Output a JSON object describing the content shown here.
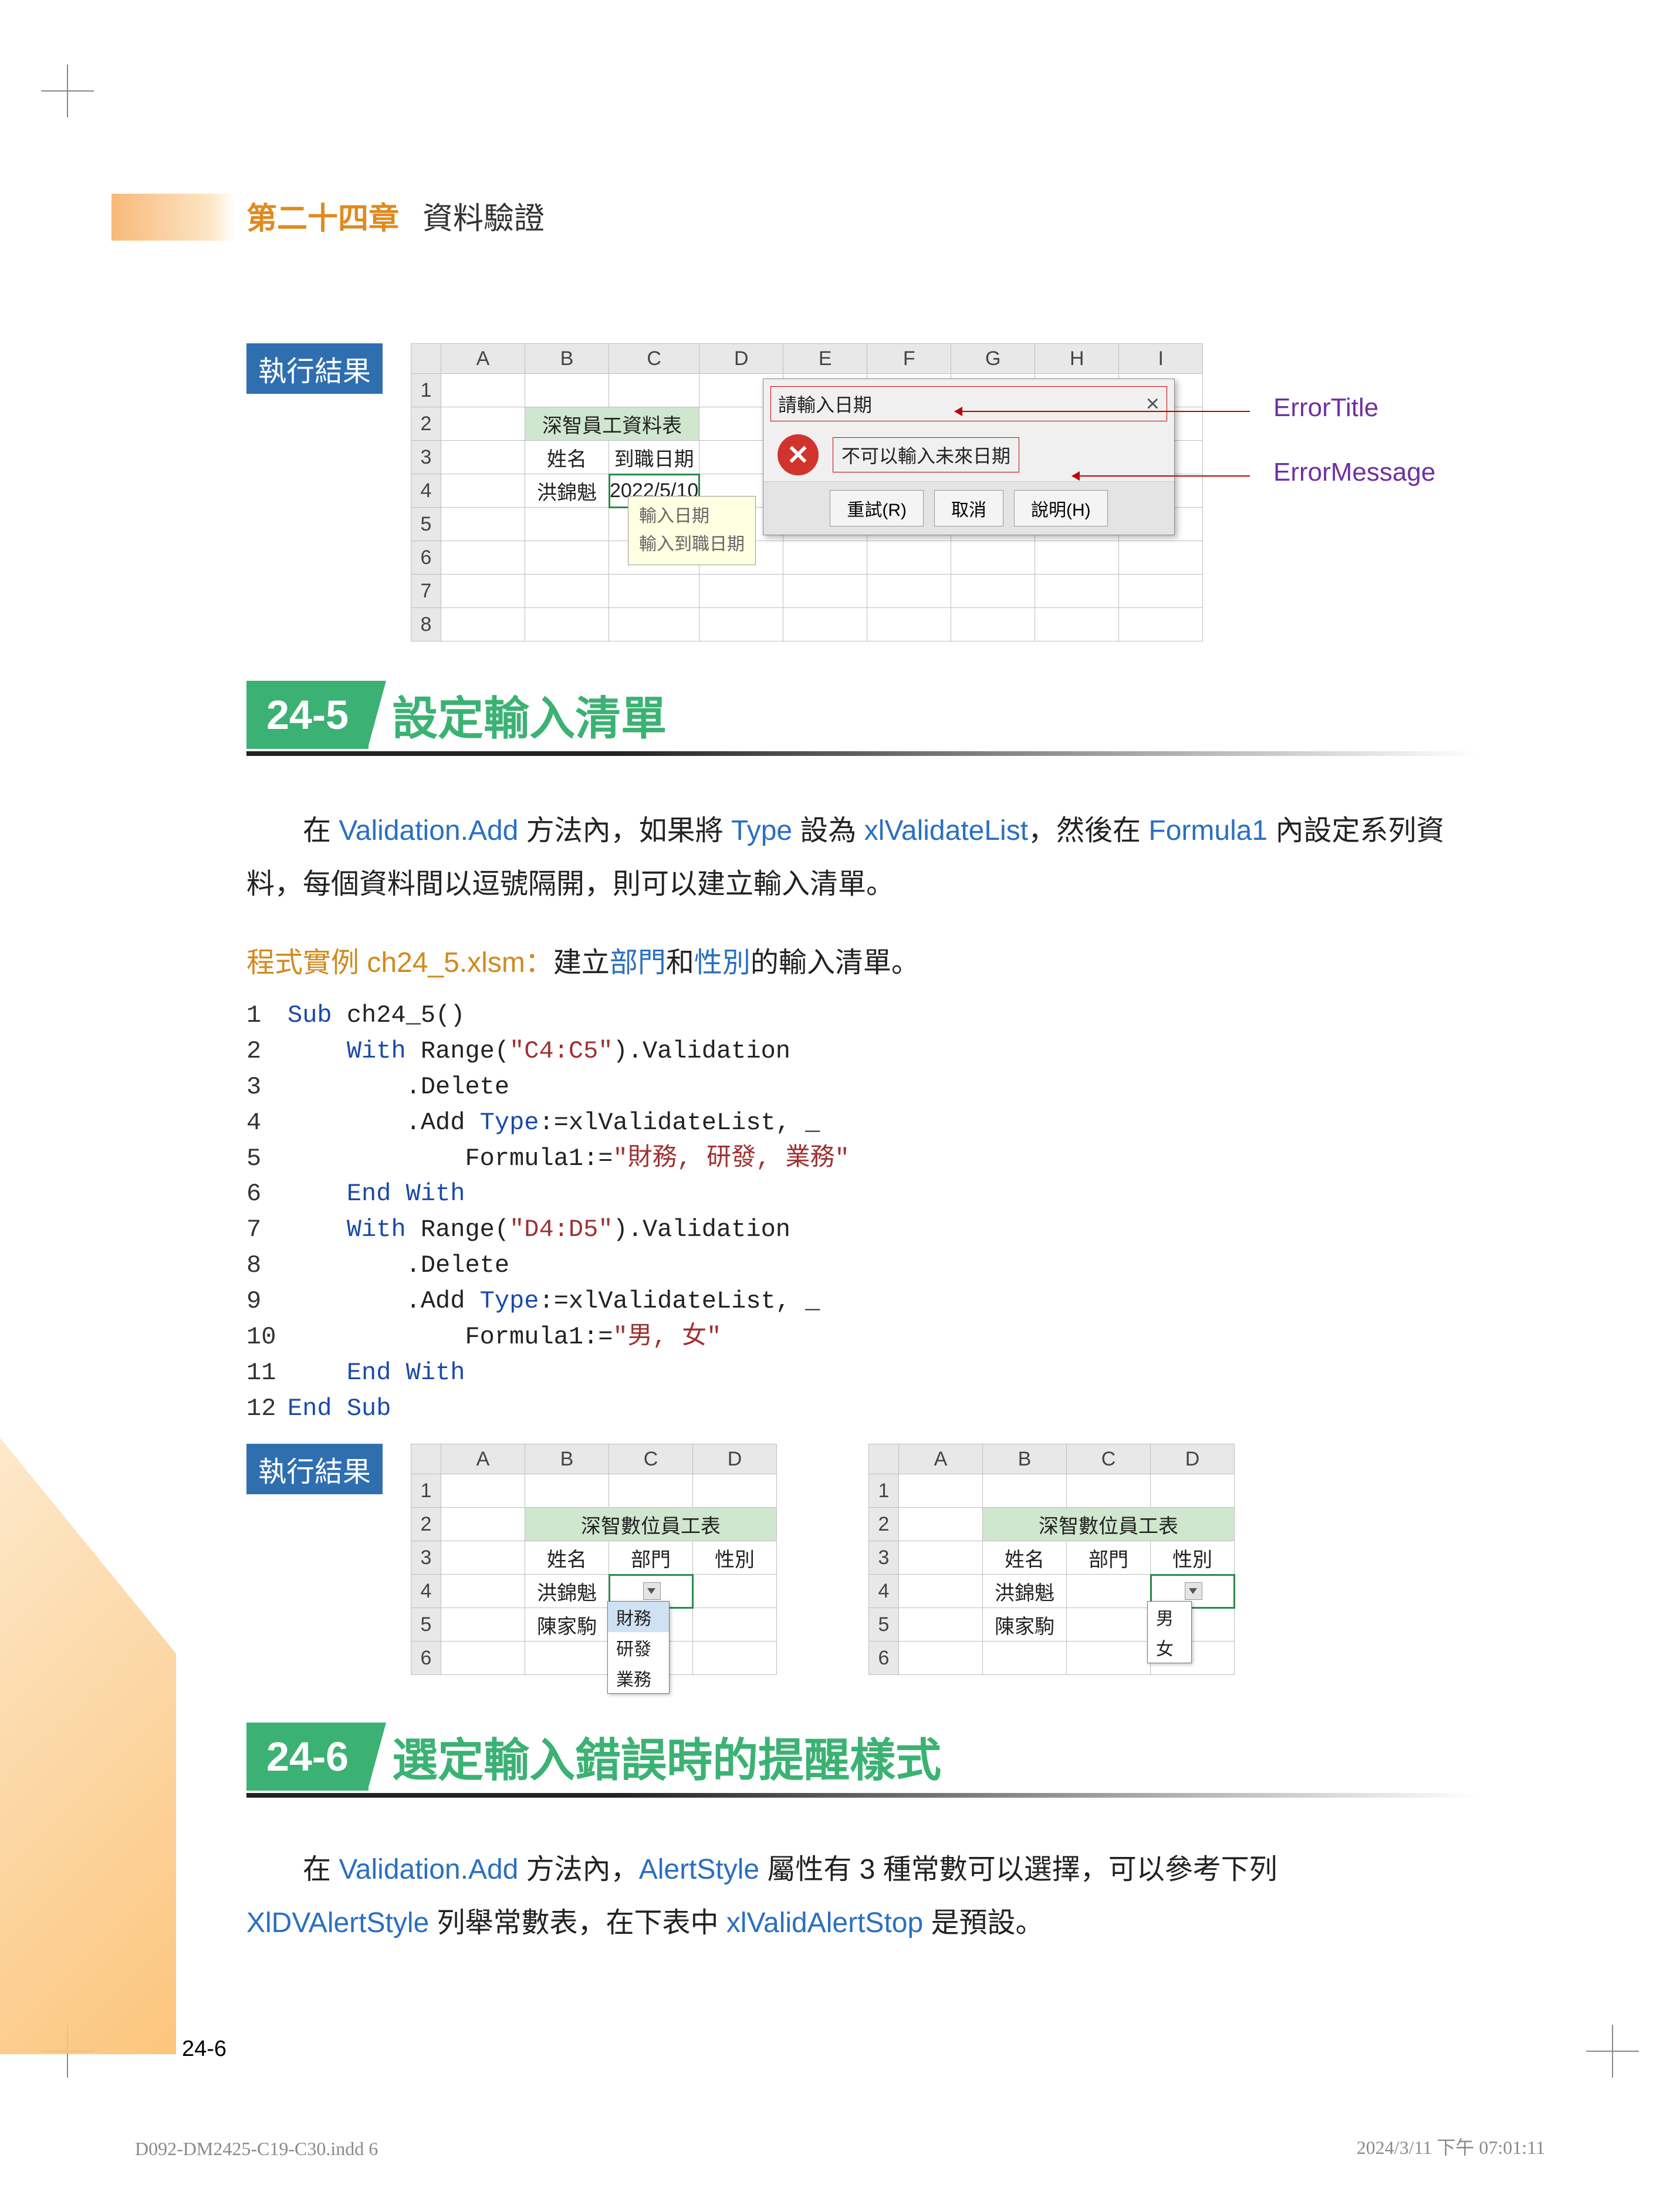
{
  "chapter": {
    "number": "第二十四章",
    "title": "資料驗證"
  },
  "labels": {
    "result": "執行結果"
  },
  "fig1": {
    "cols": [
      "A",
      "B",
      "C",
      "D",
      "E",
      "F",
      "G",
      "H",
      "I"
    ],
    "rows": [
      "1",
      "2",
      "3",
      "4",
      "5",
      "6",
      "7",
      "8"
    ],
    "merged_title": "深智員工資料表",
    "h_name": "姓名",
    "h_date": "到職日期",
    "name1": "洪錦魁",
    "date1": "2022/5/10",
    "tip_title": "輸入日期",
    "tip_body": "輸入到職日期",
    "dlg_title": "請輸入日期",
    "dlg_msg": "不可以輸入未來日期",
    "btn_retry": "重試(R)",
    "btn_cancel": "取消",
    "btn_help": "說明(H)",
    "callout_title": "ErrorTitle",
    "callout_msg": "ErrorMessage"
  },
  "sec5": {
    "num": "24-5",
    "title": "設定輸入清單"
  },
  "para1": {
    "t1": "在 ",
    "k1": "Validation.Add",
    "t2": " 方法內，如果將 ",
    "k2": "Type",
    "t3": " 設為 ",
    "k3": "xlValidateList",
    "t4": "，然後在 ",
    "k4": "Formula1",
    "t5": " 內設定系列資料，每個資料間以逗號隔開，則可以建立輸入清單。"
  },
  "example": {
    "label": "程式實例 ch24_5.xlsm：",
    "t1": "建立",
    "k1": "部門",
    "t2": "和",
    "k2": "性別",
    "t3": "的輸入清單。"
  },
  "code": [
    {
      "n": "1",
      "raw": "Sub ch24_5()",
      "kw": [
        "Sub"
      ]
    },
    {
      "n": "2",
      "raw": "    With Range(\"C4:C5\").Validation",
      "kw": [
        "With"
      ],
      "str": [
        "\"C4:C5\""
      ]
    },
    {
      "n": "3",
      "raw": "        .Delete"
    },
    {
      "n": "4",
      "raw": "        .Add Type:=xlValidateList, _",
      "kw": [
        "Type"
      ]
    },
    {
      "n": "5",
      "raw": "            Formula1:=\"財務, 研發, 業務\"",
      "str": [
        "\"財務, 研發, 業務\""
      ]
    },
    {
      "n": "6",
      "raw": "    End With",
      "kw": [
        "End",
        "With"
      ]
    },
    {
      "n": "7",
      "raw": "    With Range(\"D4:D5\").Validation",
      "kw": [
        "With"
      ],
      "str": [
        "\"D4:D5\""
      ]
    },
    {
      "n": "8",
      "raw": "        .Delete"
    },
    {
      "n": "9",
      "raw": "        .Add Type:=xlValidateList, _",
      "kw": [
        "Type"
      ]
    },
    {
      "n": "10",
      "raw": "            Formula1:=\"男, 女\"",
      "str": [
        "\"男, 女\""
      ]
    },
    {
      "n": "11",
      "raw": "    End With",
      "kw": [
        "End",
        "With"
      ]
    },
    {
      "n": "12",
      "raw": "End Sub",
      "kw": [
        "End",
        "Sub"
      ]
    }
  ],
  "fig2": {
    "cols": [
      "A",
      "B",
      "C",
      "D"
    ],
    "rows": [
      "1",
      "2",
      "3",
      "4",
      "5",
      "6"
    ],
    "merged_title": "深智數位員工表",
    "h_name": "姓名",
    "h_dept": "部門",
    "h_sex": "性別",
    "r1": "洪錦魁",
    "r2": "陳家駒",
    "dd1": [
      "財務",
      "研發",
      "業務"
    ],
    "dd2": [
      "男",
      "女"
    ]
  },
  "sec6": {
    "num": "24-6",
    "title": "選定輸入錯誤時的提醒樣式"
  },
  "para2": {
    "t1": "在 ",
    "k1": "Validation.Add",
    "t2": " 方法內，",
    "k2": "AlertStyle",
    "t3": " 屬性有 3 種常數可以選擇，可以參考下列",
    "k3": "XlDVAlertStyle",
    "t4": " 列舉常數表，在下表中 ",
    "k4": "xlValidAlertStop",
    "t5": " 是預設。"
  },
  "pagenum": "24-6",
  "footer": {
    "left": "D092-DM2425-C19-C30.indd   6",
    "right": "2024/3/11   下午 07:01:11"
  }
}
